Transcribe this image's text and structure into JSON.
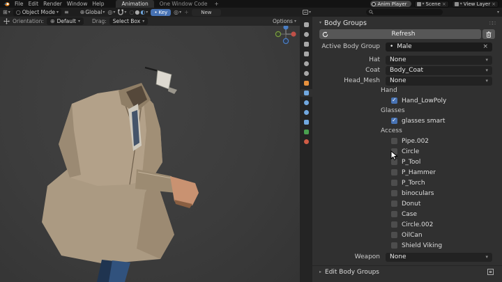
{
  "icons": {
    "chevron_down": "▾",
    "chevron_right": "▸",
    "menu": "≡",
    "close": "×",
    "dot": "•",
    "plus": "+",
    "grip": "∷∷",
    "grid": "⊞",
    "pivot": "◎",
    "globe": "⊕",
    "circle_outline": "○",
    "circle_half": "◐",
    "circle_full": "●"
  },
  "topbar": {
    "menus": [
      "File",
      "Edit",
      "Render",
      "Window",
      "Help"
    ],
    "tab_active": "Animation",
    "tab_inactive": "One Window Code",
    "tab_add": "+",
    "anim_player": "Anim Player",
    "scene": "Scene",
    "view_layer": "View Layer"
  },
  "viewport_header": {
    "mode": "Object Mode",
    "orientation": "Global",
    "key": "Key",
    "new": "New",
    "options": "Options"
  },
  "tool_settings": {
    "orientation_label": "Orientation:",
    "orientation_value": "Default",
    "drag_label": "Drag:",
    "drag_value": "Select Box"
  },
  "properties": {
    "tabs": [
      {
        "name": "tool",
        "color": "#a8a8a8",
        "active": false
      },
      {
        "name": "render",
        "color": "#a8a8a8",
        "active": false
      },
      {
        "name": "output",
        "color": "#a8a8a8",
        "active": false
      },
      {
        "name": "view-layer",
        "color": "#a8a8a8",
        "active": false
      },
      {
        "name": "scene",
        "color": "#a8a8a8",
        "active": false
      },
      {
        "name": "world",
        "color": "#a8a8a8",
        "active": false
      },
      {
        "name": "object",
        "color": "#e8913d",
        "active": false
      },
      {
        "name": "modifiers",
        "color": "#71a8e0",
        "active": true
      },
      {
        "name": "particles",
        "color": "#71a8e0",
        "active": false
      },
      {
        "name": "physics",
        "color": "#71a8e0",
        "active": false
      },
      {
        "name": "constraints",
        "color": "#71a8e0",
        "active": false
      },
      {
        "name": "object-data",
        "color": "#49a04f",
        "active": false
      },
      {
        "name": "material",
        "color": "#cf5c45",
        "active": false
      }
    ]
  },
  "panel": {
    "title": "Body Groups",
    "refresh_label": "Refresh",
    "fields": [
      {
        "label": "Active Body Group",
        "value": "Male"
      },
      {
        "label": "Hat",
        "value": "None"
      },
      {
        "label": "Coat",
        "value": "Body_Coat"
      },
      {
        "label": "Head_Mesh",
        "value": "None"
      }
    ],
    "hand": {
      "label": "Hand",
      "item": {
        "label": "Hand_LowPoly",
        "checked": true
      }
    },
    "glasses": {
      "label": "Glasses",
      "item": {
        "label": "glasses smart",
        "checked": true
      }
    },
    "access": {
      "label": "Access",
      "items": [
        {
          "label": "Pipe.002",
          "checked": false
        },
        {
          "label": "Circle",
          "checked": false
        },
        {
          "label": "P_Tool",
          "checked": false
        },
        {
          "label": "P_Hammer",
          "checked": false
        },
        {
          "label": "P_Torch",
          "checked": false
        },
        {
          "label": "binoculars",
          "checked": false
        },
        {
          "label": "Donut",
          "checked": false
        },
        {
          "label": "Case",
          "checked": false
        },
        {
          "label": "Circle.002",
          "checked": false
        },
        {
          "label": "OilCan",
          "checked": false
        },
        {
          "label": "Shield Viking",
          "checked": false
        }
      ]
    },
    "weapon_label": "Weapon",
    "weapon_value": "None",
    "edit_group": "Edit Body Groups"
  },
  "colors": {
    "accent": "#4772b3",
    "key_button": "#4772b3",
    "viewport_bg": "#3d3d3d",
    "panel_bg": "#303030",
    "coat": "#b3a189",
    "coat_skirt": "#ab9a82",
    "coat_shade": "#9c8b72",
    "collar": "#8f7e66",
    "collar_inner": "#55483a",
    "shirt": "#cfcabe",
    "tie": "#44546a",
    "skin": "#c99271",
    "skin_dark": "#8a5f42",
    "pants": "#31527d",
    "pants_dark": "#1f3450",
    "glasses_lens": "#ddd9d0"
  }
}
